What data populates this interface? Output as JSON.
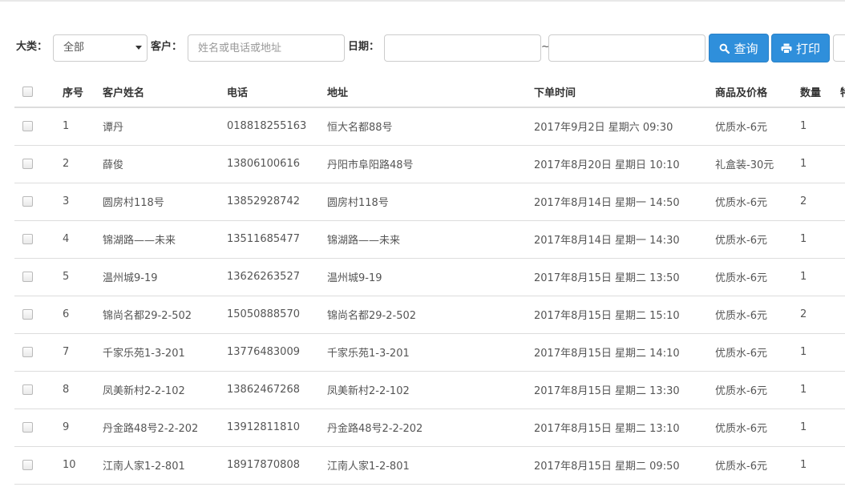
{
  "filters": {
    "category_label": "大类：",
    "category_value": "全部",
    "customer_label": "客户：",
    "customer_placeholder": "姓名或电话或地址",
    "date_label": "日期：",
    "date_start": "",
    "date_end": "",
    "range_sep": "~",
    "query_button": "查询",
    "print_button": "打印",
    "icons": {
      "query": "search-icon",
      "print": "printer-icon",
      "category": "chevron-down-icon"
    },
    "accent_color": "#2f8fdb"
  },
  "table": {
    "columns": [
      "",
      "序号",
      "客户姓名",
      "电话",
      "地址",
      "下单时间",
      "商品及价格",
      "数量",
      "特"
    ],
    "rows": [
      [
        "1",
        "谭丹",
        "018818255163",
        "恒大名都88号",
        "2017年9月2日 星期六 09:30",
        "优质水-6元",
        "1"
      ],
      [
        "2",
        "薛俊",
        "13806100616",
        "丹阳市阜阳路48号",
        "2017年8月20日 星期日 10:10",
        "礼盒装-30元",
        "1"
      ],
      [
        "3",
        "圆房村118号",
        "13852928742",
        "圆房村118号",
        "2017年8月14日 星期一 14:50",
        "优质水-6元",
        "2"
      ],
      [
        "4",
        "锦湖路——未来",
        "13511685477",
        "锦湖路——未来",
        "2017年8月14日 星期一 14:30",
        "优质水-6元",
        "1"
      ],
      [
        "5",
        "温州城9-19",
        "13626263527",
        "温州城9-19",
        "2017年8月15日 星期二 13:50",
        "优质水-6元",
        "1"
      ],
      [
        "6",
        "锦尚名都29-2-502",
        "15050888570",
        "锦尚名都29-2-502",
        "2017年8月15日 星期二 15:10",
        "优质水-6元",
        "2"
      ],
      [
        "7",
        "千家乐苑1-3-201",
        "13776483009",
        "千家乐苑1-3-201",
        "2017年8月15日 星期二 14:10",
        "优质水-6元",
        "1"
      ],
      [
        "8",
        "凤美新村2-2-102",
        "13862467268",
        "凤美新村2-2-102",
        "2017年8月15日 星期二 13:30",
        "优质水-6元",
        "1"
      ],
      [
        "9",
        "丹金路48号2-2-202",
        "13912811810",
        "丹金路48号2-2-202",
        "2017年8月15日 星期二 13:10",
        "优质水-6元",
        "1"
      ],
      [
        "10",
        "江南人家1-2-801",
        "18917870808",
        "江南人家1-2-801",
        "2017年8月15日 星期二 09:50",
        "优质水-6元",
        "1"
      ]
    ]
  }
}
